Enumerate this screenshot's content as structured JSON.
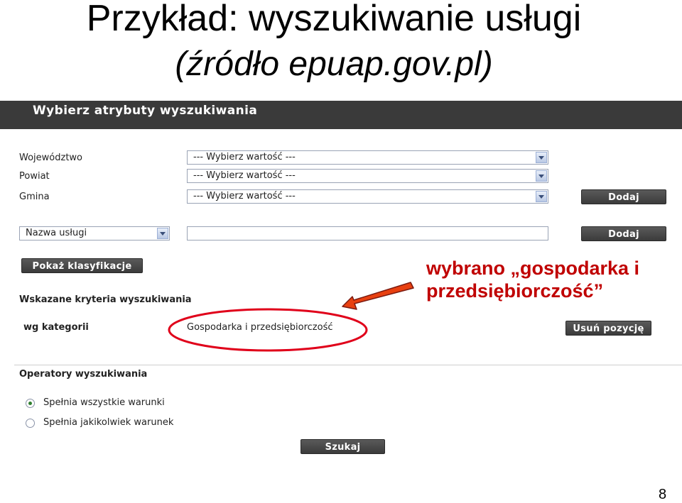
{
  "slide": {
    "title": "Przykład: wyszukiwanie usługi",
    "subtitle": "(źródło epuap.gov.pl)",
    "page_number": "8"
  },
  "header": {
    "title": "Wybierz atrybuty wyszukiwania"
  },
  "form": {
    "wojewodztwo": {
      "label": "Województwo",
      "value": "--- Wybierz wartość ---"
    },
    "powiat": {
      "label": "Powiat",
      "value": "--- Wybierz wartość ---"
    },
    "gmina": {
      "label": "Gmina",
      "value": "--- Wybierz wartość ---"
    },
    "add_location_label": "Dodaj",
    "search_field": {
      "value": "Nazwa usługi",
      "text_value": ""
    },
    "add_criterion_label": "Dodaj",
    "show_classification_label": "Pokaż klasyfikacje"
  },
  "criteria": {
    "heading": "Wskazane kryteria wyszukiwania",
    "row": {
      "type": "wg kategorii",
      "value": "Gospodarka i przedsiębiorczość",
      "remove_label": "Usuń pozycję"
    }
  },
  "operators": {
    "heading": "Operatory wyszukiwania",
    "options": [
      {
        "label": "Spełnia wszystkie warunki",
        "checked": true
      },
      {
        "label": "Spełnia jakikolwiek warunek",
        "checked": false
      }
    ],
    "search_label": "Szukaj"
  },
  "annotation": {
    "line1": "wybrano „gospodarka i",
    "line2": "przedsiębiorczość”",
    "color": "#c00000"
  },
  "colors": {
    "header_bar": "#3a3a3a",
    "button": "#4a4a4a",
    "highlight": "#e0001a"
  }
}
